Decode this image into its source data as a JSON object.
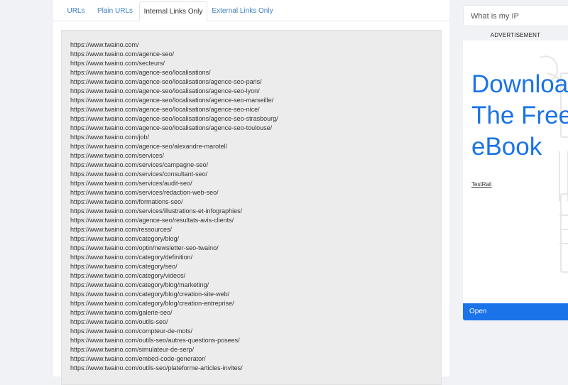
{
  "tabs": [
    {
      "label": "URLs",
      "active": false
    },
    {
      "label": "Plain URLs",
      "active": false
    },
    {
      "label": "Internal Links Only",
      "active": true
    },
    {
      "label": "External Links Only",
      "active": false
    }
  ],
  "urls": [
    "https://www.twaino.com/",
    "https://www.twaino.com/agence-seo/",
    "https://www.twaino.com/secteurs/",
    "https://www.twaino.com/agence-seo/localisations/",
    "https://www.twaino.com/agence-seo/localisations/agence-seo-paris/",
    "https://www.twaino.com/agence-seo/localisations/agence-seo-lyon/",
    "https://www.twaino.com/agence-seo/localisations/agence-seo-marseille/",
    "https://www.twaino.com/agence-seo/localisations/agence-seo-nice/",
    "https://www.twaino.com/agence-seo/localisations/agence-seo-strasbourg/",
    "https://www.twaino.com/agence-seo/localisations/agence-seo-toulouse/",
    "https://www.twaino.com/job/",
    "https://www.twaino.com/agence-seo/alexandre-marotel/",
    "https://www.twaino.com/services/",
    "https://www.twaino.com/services/campagne-seo/",
    "https://www.twaino.com/services/consultant-seo/",
    "https://www.twaino.com/services/audit-seo/",
    "https://www.twaino.com/services/redaction-web-seo/",
    "https://www.twaino.com/formations-seo/",
    "https://www.twaino.com/services/illustrations-et-infographies/",
    "https://www.twaino.com/agence-seo/resultats-avis-clients/",
    "https://www.twaino.com/ressources/",
    "https://www.twaino.com/category/blog/",
    "https://www.twaino.com/optin/newsletter-seo-twaino/",
    "https://www.twaino.com/category/definition/",
    "https://www.twaino.com/category/seo/",
    "https://www.twaino.com/category/videos/",
    "https://www.twaino.com/category/blog/marketing/",
    "https://www.twaino.com/category/blog/creation-site-web/",
    "https://www.twaino.com/category/blog/creation-entreprise/",
    "https://www.twaino.com/galerie-seo/",
    "https://www.twaino.com/outils-seo/",
    "https://www.twaino.com/compteur-de-mots/",
    "https://www.twaino.com/outils-seo/autres-questions-posees/",
    "https://www.twaino.com/simulateur-de-serp/",
    "https://www.twaino.com/embed-code-generator/",
    "https://www.twaino.com/outils-seo/plateforme-articles-invites/"
  ],
  "sidebar": {
    "search_text": "What is my IP",
    "ad_label": "ADVERTISEMENT",
    "ad": {
      "headline": [
        "Downloa",
        "The Free",
        "eBook"
      ],
      "brand": "TestRail",
      "open_label": "Open",
      "accent_color": "#1a73e8"
    }
  }
}
